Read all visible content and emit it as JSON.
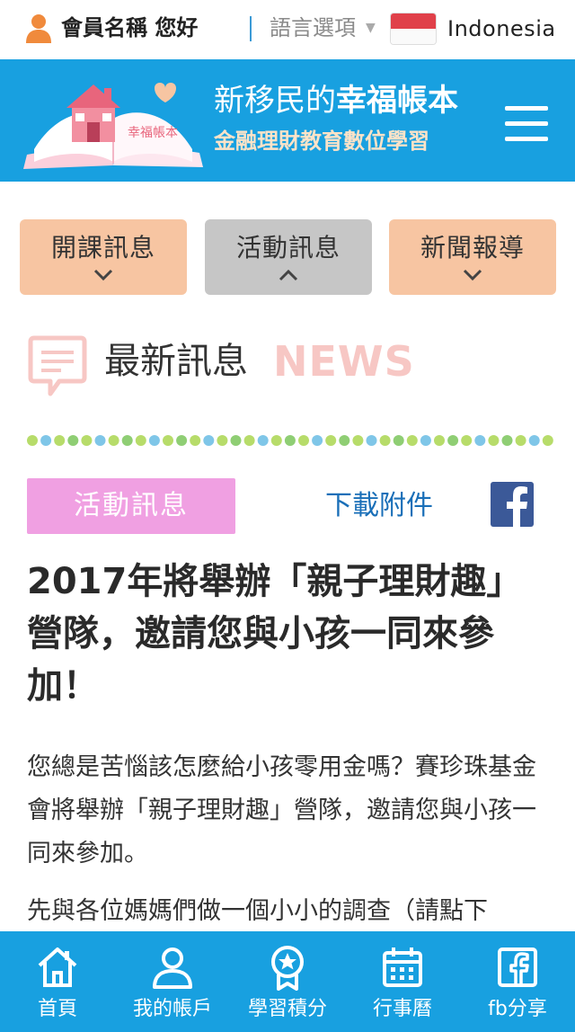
{
  "topbar": {
    "user_label": "會員名稱 您好",
    "language_label": "語言選項",
    "language_value": "Indonesia"
  },
  "header": {
    "logo_text": "幸福帳本",
    "title_prefix": "新移民的",
    "title_accent": "幸福帳本",
    "subtitle": "金融理財教育數位學習"
  },
  "tabs": [
    {
      "label": "開課訊息",
      "chevron": "⌄",
      "state": "collapsed"
    },
    {
      "label": "活動訊息",
      "chevron": "⌃",
      "state": "expanded"
    },
    {
      "label": "新聞報導",
      "chevron": "⌄",
      "state": "collapsed"
    }
  ],
  "news": {
    "heading": "最新訊息",
    "heading_en": "NEWS"
  },
  "article": {
    "category": "活動訊息",
    "download_label": "下載附件",
    "title": "2017年將舉辦「親子理財趣」營隊，邀請您與小孩一同來參加！",
    "paragraphs": [
      "您總是苦惱該怎麼給小孩零用金嗎？賽珍珠基金會將舉辦「親子理財趣」營隊，邀請您與小孩一同來參加。",
      "先與各位媽媽們做一個小小的調查（請點下"
    ]
  },
  "bottom_nav": [
    {
      "label": "首頁",
      "icon": "home-icon"
    },
    {
      "label": "我的帳戶",
      "icon": "user-icon"
    },
    {
      "label": "學習積分",
      "icon": "medal-icon"
    },
    {
      "label": "行事曆",
      "icon": "calendar-icon"
    },
    {
      "label": "fb分享",
      "icon": "facebook-icon"
    }
  ],
  "colors": {
    "brand_blue": "#18a0e0",
    "tab_peach": "#f7c5a2",
    "tab_active_gray": "#c6c6c6",
    "category_pink": "#f0a0e2",
    "link_blue": "#1a6fb8",
    "facebook_blue": "#3b5998"
  }
}
